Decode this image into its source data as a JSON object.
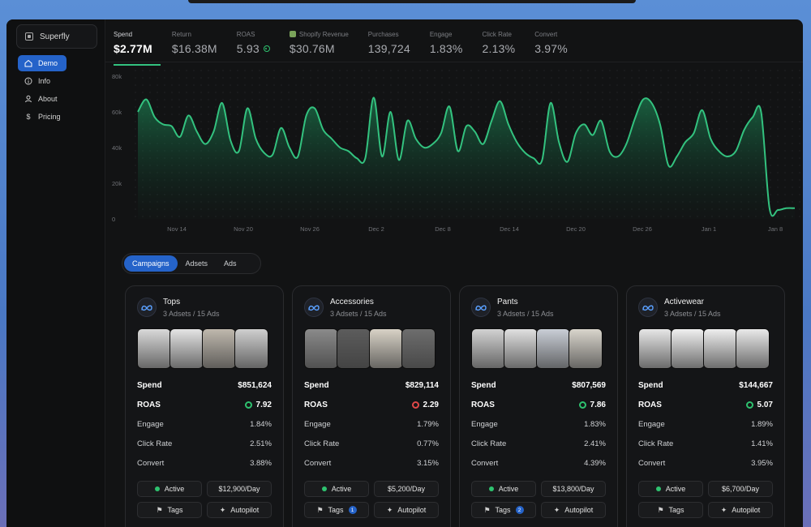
{
  "app": {
    "brand": "Superfly"
  },
  "sidebar": {
    "items": [
      {
        "label": "Demo",
        "icon": "home-icon"
      },
      {
        "label": "Info",
        "icon": "info-icon"
      },
      {
        "label": "About",
        "icon": "user-icon"
      },
      {
        "label": "Pricing",
        "icon": "dollar-icon"
      }
    ]
  },
  "kpis": [
    {
      "label": "Spend",
      "value": "$2.77M"
    },
    {
      "label": "Return",
      "value": "$16.38M"
    },
    {
      "label": "ROAS",
      "value": "5.93"
    },
    {
      "label": "Shopify Revenue",
      "value": "$30.76M"
    },
    {
      "label": "Purchases",
      "value": "139,724"
    },
    {
      "label": "Engage",
      "value": "1.83%"
    },
    {
      "label": "Click Rate",
      "value": "2.13%"
    },
    {
      "label": "Convert",
      "value": "3.97%"
    }
  ],
  "colors": {
    "accent": "#2563c9",
    "line": "#33c27f",
    "good": "#2ec26f",
    "bad": "#e04848"
  },
  "chart_data": {
    "type": "area",
    "yticks": [
      "0",
      "20k",
      "40k",
      "60k",
      "80k"
    ],
    "ylim": [
      0,
      80000
    ],
    "xticks": [
      "Nov 14",
      "Nov 20",
      "Nov 26",
      "Dec 2",
      "Dec 8",
      "Dec 14",
      "Dec 20",
      "Dec 26",
      "Jan 1",
      "Jan 8"
    ],
    "values": [
      60000,
      67000,
      57000,
      53000,
      52000,
      46000,
      58000,
      49000,
      42000,
      49000,
      65000,
      44000,
      38000,
      62000,
      45000,
      37000,
      36000,
      51000,
      40000,
      35000,
      58000,
      62000,
      50000,
      45000,
      40000,
      38000,
      34000,
      34000,
      68000,
      35000,
      60000,
      33000,
      55000,
      45000,
      40000,
      42000,
      48000,
      63000,
      38000,
      52000,
      49000,
      42000,
      55000,
      66000,
      53000,
      43000,
      37000,
      34000,
      33000,
      65000,
      43000,
      32000,
      48000,
      53000,
      47000,
      55000,
      38000,
      35000,
      42000,
      56000,
      67000,
      65000,
      53000,
      30000,
      35000,
      43000,
      48000,
      61000,
      45000,
      38000,
      35000,
      38000,
      50000,
      57000,
      60000,
      6000,
      5000,
      6000,
      6000
    ]
  },
  "tabs": [
    "Campaigns",
    "Adsets",
    "Ads"
  ],
  "cards": [
    {
      "title": "Tops",
      "sub": "3 Adsets / 15 Ads",
      "spend_label": "Spend",
      "spend": "$851,624",
      "roas_label": "ROAS",
      "roas": "7.92",
      "roas_status": "good",
      "engage_label": "Engage",
      "engage": "1.84%",
      "click_label": "Click Rate",
      "click": "2.51%",
      "convert_label": "Convert",
      "convert": "3.88%",
      "status": "Active",
      "budget": "$12,900/Day",
      "tags": "Tags",
      "tags_count": "",
      "autopilot": "Autopilot",
      "thumbs": [
        "#d9d9d9",
        "#e4e4e4",
        "#bfb8ad",
        "#cfcfcf"
      ]
    },
    {
      "title": "Accessories",
      "sub": "3 Adsets / 15 Ads",
      "spend_label": "Spend",
      "spend": "$829,114",
      "roas_label": "ROAS",
      "roas": "2.29",
      "roas_status": "bad",
      "engage_label": "Engage",
      "engage": "1.79%",
      "click_label": "Click Rate",
      "click": "0.77%",
      "convert_label": "Convert",
      "convert": "3.15%",
      "status": "Active",
      "budget": "$5,200/Day",
      "tags": "Tags",
      "tags_count": "1",
      "autopilot": "Autopilot",
      "thumbs": [
        "#8a8a8a",
        "#5c5c5c",
        "#d8d2c6",
        "#6d6d6d"
      ]
    },
    {
      "title": "Pants",
      "sub": "3 Adsets / 15 Ads",
      "spend_label": "Spend",
      "spend": "$807,569",
      "roas_label": "ROAS",
      "roas": "7.86",
      "roas_status": "good",
      "engage_label": "Engage",
      "engage": "1.83%",
      "click_label": "Click Rate",
      "click": "2.41%",
      "convert_label": "Convert",
      "convert": "4.39%",
      "status": "Active",
      "budget": "$13,800/Day",
      "tags": "Tags",
      "tags_count": "2",
      "autopilot": "Autopilot",
      "thumbs": [
        "#d2d2d2",
        "#e0e0e0",
        "#c9ced6",
        "#d9d5cc"
      ]
    },
    {
      "title": "Activewear",
      "sub": "3 Adsets / 15 Ads",
      "spend_label": "Spend",
      "spend": "$144,667",
      "roas_label": "ROAS",
      "roas": "5.07",
      "roas_status": "good",
      "engage_label": "Engage",
      "engage": "1.89%",
      "click_label": "Click Rate",
      "click": "1.41%",
      "convert_label": "Convert",
      "convert": "3.95%",
      "status": "Active",
      "budget": "$6,700/Day",
      "tags": "Tags",
      "tags_count": "",
      "autopilot": "Autopilot",
      "thumbs": [
        "#e6e6e6",
        "#f0f0f0",
        "#eeeeee",
        "#e9e9e9"
      ]
    }
  ]
}
